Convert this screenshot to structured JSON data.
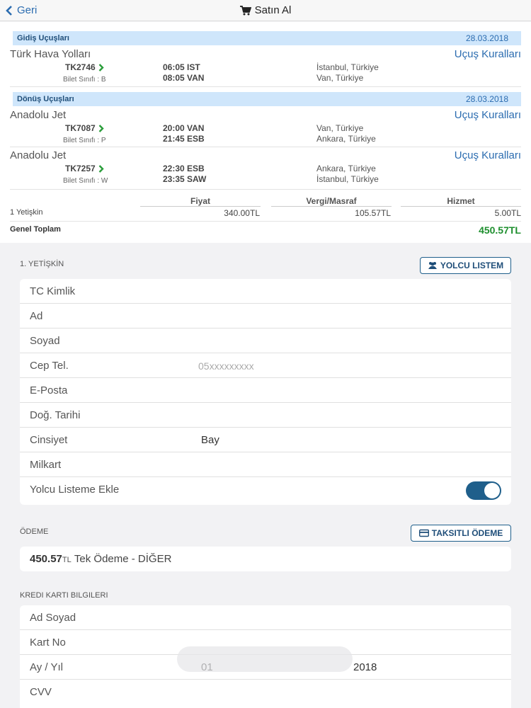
{
  "nav": {
    "back_label": "Geri",
    "title": "Satın Al",
    "back_icon": "chevron-left-icon",
    "title_icon": "cart-icon"
  },
  "outbound": {
    "header": "Gidiş Uçuşları",
    "date": "28.03.2018",
    "flights": [
      {
        "airline": "Türk Hava Yolları",
        "rules": "Uçuş Kuralları",
        "code": "TK2746",
        "class": "Bilet Sınıfı : B",
        "dep_time": "06:05 IST",
        "arr_time": "08:05 VAN",
        "dep_loc": "İstanbul, Türkiye",
        "arr_loc": "Van, Türkiye"
      }
    ]
  },
  "return": {
    "header": "Dönüş Uçuşları",
    "date": "28.03.2018",
    "flights": [
      {
        "airline": "Anadolu Jet",
        "rules": "Uçuş Kuralları",
        "code": "TK7087",
        "class": "Bilet Sınıfı : P",
        "dep_time": "20:00 VAN",
        "arr_time": "21:45 ESB",
        "dep_loc": "Van, Türkiye",
        "arr_loc": "Ankara, Türkiye"
      },
      {
        "airline": "Anadolu Jet",
        "rules": "Uçuş Kuralları",
        "code": "TK7257",
        "class": "Bilet Sınıfı : W",
        "dep_time": "22:30 ESB",
        "arr_time": "23:35 SAW",
        "dep_loc": "Ankara, Türkiye",
        "arr_loc": "İstanbul, Türkiye"
      }
    ]
  },
  "pricing": {
    "headers": [
      "Fiyat",
      "Vergi/Masraf",
      "Hizmet"
    ],
    "passenger_label": "1 Yetişkin",
    "values": [
      "340.00TL",
      "105.57TL",
      "5.00TL"
    ],
    "total_label": "Genel Toplam",
    "total_value": "450.57TL"
  },
  "passenger": {
    "section_label": "1. YETİŞKİN",
    "list_button": "YOLCU LISTEM",
    "fields": {
      "tc": "TC Kimlik",
      "name": "Ad",
      "surname": "Soyad",
      "phone": "Cep Tel.",
      "phone_placeholder": "05xxxxxxxxx",
      "email": "E-Posta",
      "birth": "Doğ. Tarihi",
      "gender": "Cinsiyet",
      "gender_value": "Bay",
      "milcard": "Milkart",
      "add_to_list": "Yolcu Listeme Ekle"
    },
    "add_to_list_on": true
  },
  "payment": {
    "section_label": "ÖDEME",
    "installment_button": "TAKSITLI ÖDEME",
    "amount": "450.57",
    "currency": "TL",
    "description": "Tek Ödeme - DİĞER"
  },
  "card": {
    "section_label": "KREDI KARTI BILGILERI",
    "holder": "Ad Soyad",
    "number": "Kart No",
    "expiry": "Ay / Yıl",
    "month": "01",
    "year": "2018",
    "cvv": "CVV"
  },
  "colors": {
    "accent": "#2b6cb0",
    "toggle": "#1f5f8b",
    "total": "#1e8f2e",
    "section_bg": "#cfe6fb"
  }
}
